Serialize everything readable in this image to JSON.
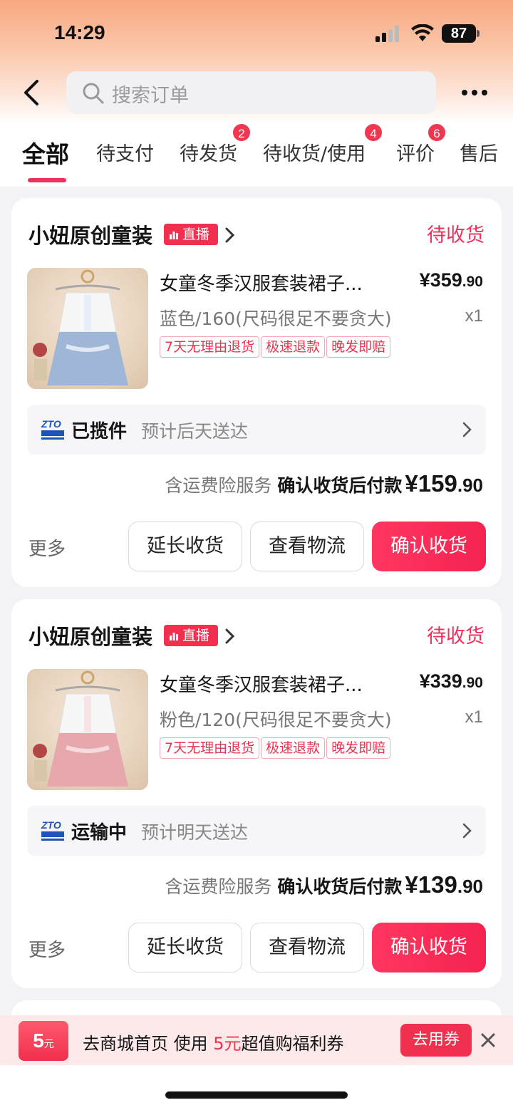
{
  "status_bar": {
    "time": "14:29",
    "battery": "87"
  },
  "search": {
    "placeholder": "搜索订单"
  },
  "tabs": [
    {
      "label": "全部",
      "badge": ""
    },
    {
      "label": "待支付",
      "badge": ""
    },
    {
      "label": "待发货",
      "badge": "2"
    },
    {
      "label": "待收货/使用",
      "badge": "4"
    },
    {
      "label": "评价",
      "badge": "6"
    },
    {
      "label": "售后",
      "badge": ""
    }
  ],
  "orders": [
    {
      "shop": "小妞原创童装",
      "live_tag": "直播",
      "status": "待收货",
      "item": {
        "title": "女童冬季汉服套装裙子...",
        "price_currency": "¥",
        "price_main": "359",
        "price_cents": ".90",
        "sku": "蓝色/160(尺码很足不要贪大)",
        "qty": "x1",
        "tags": [
          "7天无理由退货",
          "极速退款",
          "晚发即赔"
        ]
      },
      "logistics": {
        "status": "已揽件",
        "eta": "预计后天送达"
      },
      "payment": {
        "note": "含运费险服务",
        "label": "确认收货后付款",
        "currency": "¥",
        "amount_main": "159",
        "amount_cents": ".90"
      },
      "actions": {
        "more": "更多",
        "extend": "延长收货",
        "track": "查看物流",
        "confirm": "确认收货"
      }
    },
    {
      "shop": "小妞原创童装",
      "live_tag": "直播",
      "status": "待收货",
      "item": {
        "title": "女童冬季汉服套装裙子...",
        "price_currency": "¥",
        "price_main": "339",
        "price_cents": ".90",
        "sku": "粉色/120(尺码很足不要贪大)",
        "qty": "x1",
        "tags": [
          "7天无理由退货",
          "极速退款",
          "晚发即赔"
        ]
      },
      "logistics": {
        "status": "运输中",
        "eta": "预计明天送达"
      },
      "payment": {
        "note": "含运费险服务",
        "label": "确认收货后付款",
        "currency": "¥",
        "amount_main": "139",
        "amount_cents": ".90"
      },
      "actions": {
        "more": "更多",
        "extend": "延长收货",
        "track": "查看物流",
        "confirm": "确认收货"
      }
    }
  ],
  "promo": {
    "coupon_value": "5",
    "coupon_unit": "元",
    "text_before": "去商城首页 使用",
    "text_highlight": "5元",
    "text_after": "超值购福利券",
    "button": "去用券"
  },
  "colors": {
    "accent": "#f0305b",
    "live": "#f0304e",
    "badge": "#f2364f"
  }
}
